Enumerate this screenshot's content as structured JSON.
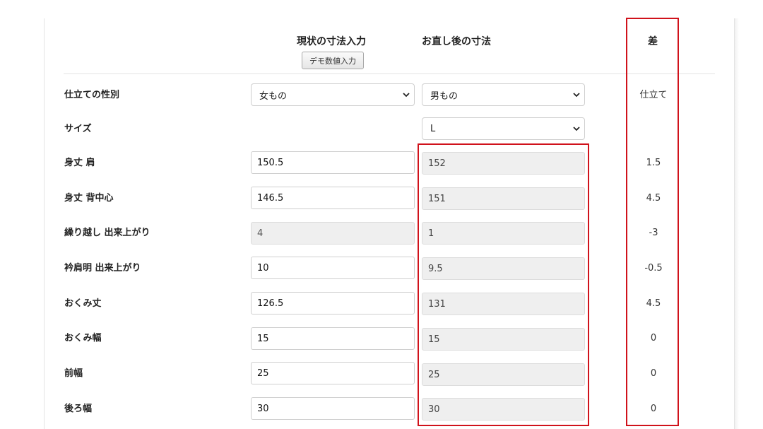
{
  "headers": {
    "current": "現状の寸法入力",
    "after": "お直し後の寸法",
    "diff": "差",
    "demo_button": "デモ数値入力"
  },
  "rows": [
    {
      "label": "仕立ての性別",
      "current_select": "女もの",
      "after_select": "男もの",
      "diff": "仕立て"
    },
    {
      "label": "サイズ",
      "after_select": "L",
      "diff": ""
    },
    {
      "label": "身丈 肩",
      "current": "150.5",
      "after": "152",
      "diff": "1.5"
    },
    {
      "label": "身丈 背中心",
      "current": "146.5",
      "after": "151",
      "diff": "4.5"
    },
    {
      "label": "繰り越し 出来上がり",
      "current": "4",
      "after": "1",
      "diff": "-3"
    },
    {
      "label": "衿肩明 出来上がり",
      "current": "10",
      "after": "9.5",
      "diff": "-0.5"
    },
    {
      "label": "おくみ丈",
      "current": "126.5",
      "after": "131",
      "diff": "4.5"
    },
    {
      "label": "おくみ幅",
      "current": "15",
      "after": "15",
      "diff": "0"
    },
    {
      "label": "前幅",
      "current": "25",
      "after": "25",
      "diff": "0"
    },
    {
      "label": "後ろ幅",
      "current": "30",
      "after": "30",
      "diff": "0"
    }
  ],
  "colors": {
    "highlight": "#d0121b",
    "readonly_bg": "#efefef",
    "border": "#cfcfcf"
  }
}
